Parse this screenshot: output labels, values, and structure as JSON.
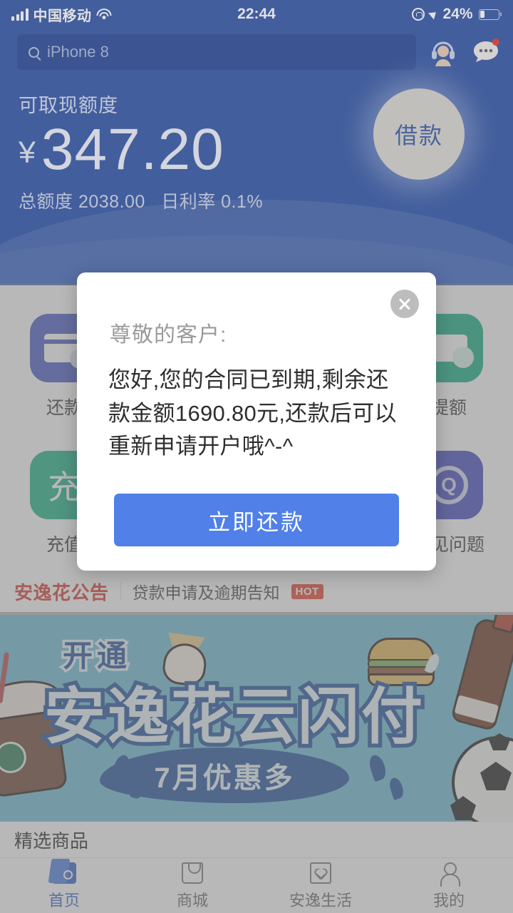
{
  "status_bar": {
    "carrier": "中国移动",
    "time": "22:44",
    "battery_percent": "24%",
    "battery_level": 24,
    "icons": [
      "signal-icon",
      "wifi-icon",
      "rotation-lock-icon",
      "location-arrow-icon",
      "battery-icon"
    ]
  },
  "search": {
    "placeholder": "iPhone 8",
    "icon": "search-icon"
  },
  "header_icons": {
    "service": "customer-service-icon",
    "message": "message-bubble-icon",
    "message_badge": true
  },
  "credit": {
    "label": "可取现额度",
    "currency": "¥",
    "available": "347.20",
    "total_label": "总额度",
    "total": "2038.00",
    "rate_label": "日利率",
    "rate": "0.1%",
    "borrow_button": "借款"
  },
  "quick_actions": [
    {
      "label": "还款",
      "icon": "card-refund-icon",
      "color": "#4659c4"
    },
    {
      "label": "",
      "icon": "",
      "color": ""
    },
    {
      "label": "",
      "icon": "",
      "color": ""
    },
    {
      "label": "提额",
      "icon": "coins-up-icon",
      "color": "#18b184"
    },
    {
      "label": "充值",
      "icon": "recharge-icon",
      "color": "#18b184"
    },
    {
      "label": "",
      "icon": "",
      "color": ""
    },
    {
      "label": "",
      "icon": "",
      "color": ""
    },
    {
      "label": "常见问题",
      "icon": "question-bubble-icon",
      "color": "#3f48c0"
    }
  ],
  "notice": {
    "brand": "安逸花公告",
    "text": "贷款申请及逾期告知",
    "badge": "HOT"
  },
  "banner": {
    "top_text": "开通",
    "main_text": "安逸花云闪付",
    "sub_text": "7月优惠多",
    "background": "#6cbcd4"
  },
  "featured": {
    "title": "精选商品"
  },
  "tabs": [
    {
      "label": "首页",
      "icon": "wallet-icon",
      "active": true
    },
    {
      "label": "商城",
      "icon": "shopping-bag-icon",
      "active": false
    },
    {
      "label": "安逸生活",
      "icon": "life-heart-icon",
      "active": false
    },
    {
      "label": "我的",
      "icon": "person-icon",
      "active": false
    }
  ],
  "modal": {
    "greeting": "尊敬的客户:",
    "message": "您好,您的合同已到期,剩余还款金额1690.80元,还款后可以重新申请开户哦^-^",
    "button_label": "立即还款",
    "close_icon": "close-icon",
    "accent_color": "#5080e8"
  }
}
